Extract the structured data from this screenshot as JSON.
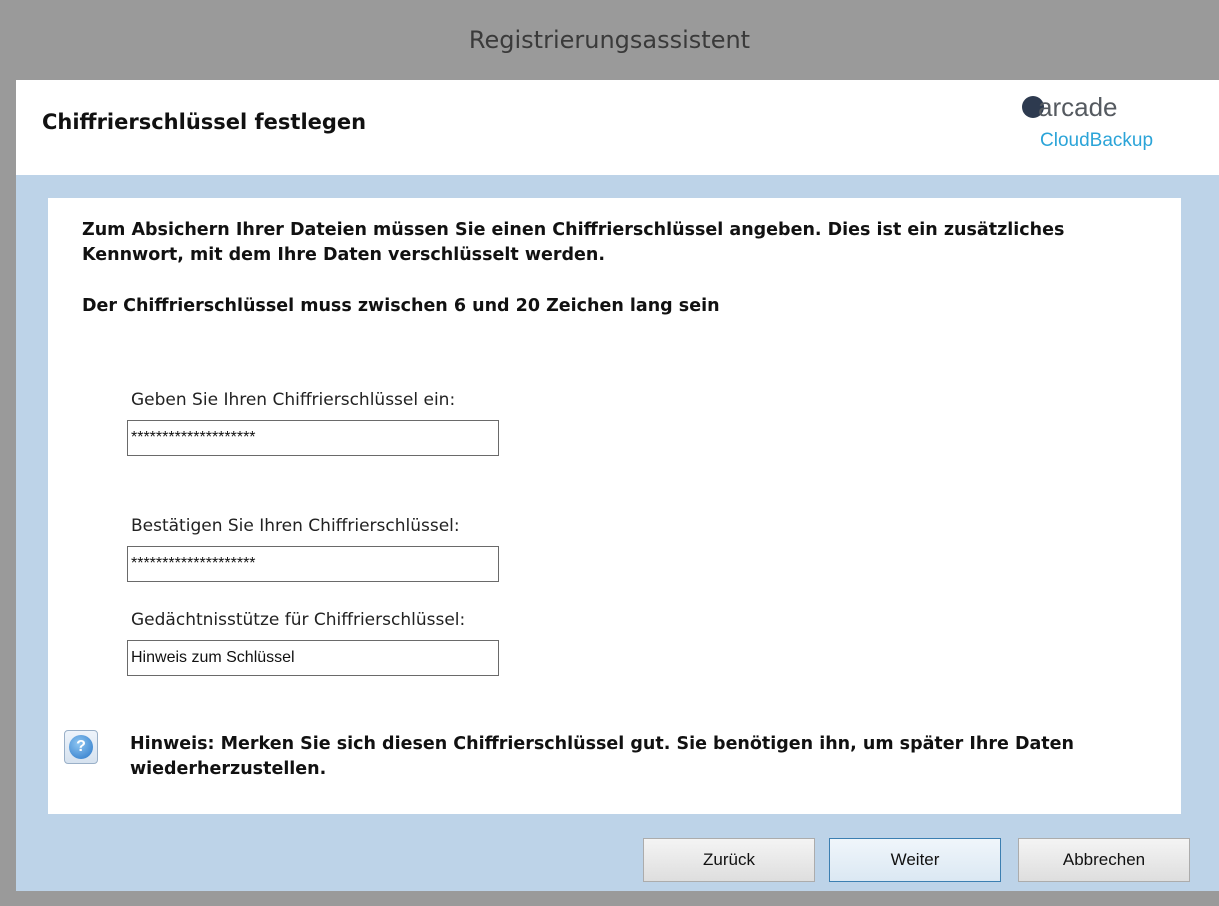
{
  "window": {
    "title": "Registrierungsassistent"
  },
  "header": {
    "title": "Chiffrierschlüssel festlegen",
    "logo": {
      "word": "arcade",
      "sub": "CloudBackup"
    }
  },
  "content": {
    "intro": "Zum Absichern Ihrer Dateien müssen Sie einen Chiffrierschlüssel angeben. Dies ist ein zusätzliches Kennwort, mit dem Ihre Daten verschlüsselt werden.",
    "rule": "Der Chiffrierschlüssel muss zwischen 6 und 20 Zeichen lang sein",
    "fields": {
      "key": {
        "label": "Geben Sie Ihren Chiffrierschlüssel ein:",
        "value": "********************"
      },
      "confirm": {
        "label": "Bestätigen Sie Ihren Chiffrierschlüssel:",
        "value": "********************"
      },
      "hint": {
        "label": "Gedächtnisstütze für Chiffrierschlüssel:",
        "value": "Hinweis zum Schlüssel"
      }
    },
    "info_icon": "help-icon",
    "note": "Hinweis: Merken Sie sich diesen Chiffrierschlüssel gut. Sie benötigen ihn, um später Ihre Daten wiederherzustellen."
  },
  "buttons": {
    "back": "Zurück",
    "next": "Weiter",
    "cancel": "Abbrechen"
  },
  "colors": {
    "frame": "#9a9a9a",
    "client": "#bdd3e8",
    "logo_accent": "#2ba4d8",
    "default_button_border": "#3c7fb1"
  }
}
